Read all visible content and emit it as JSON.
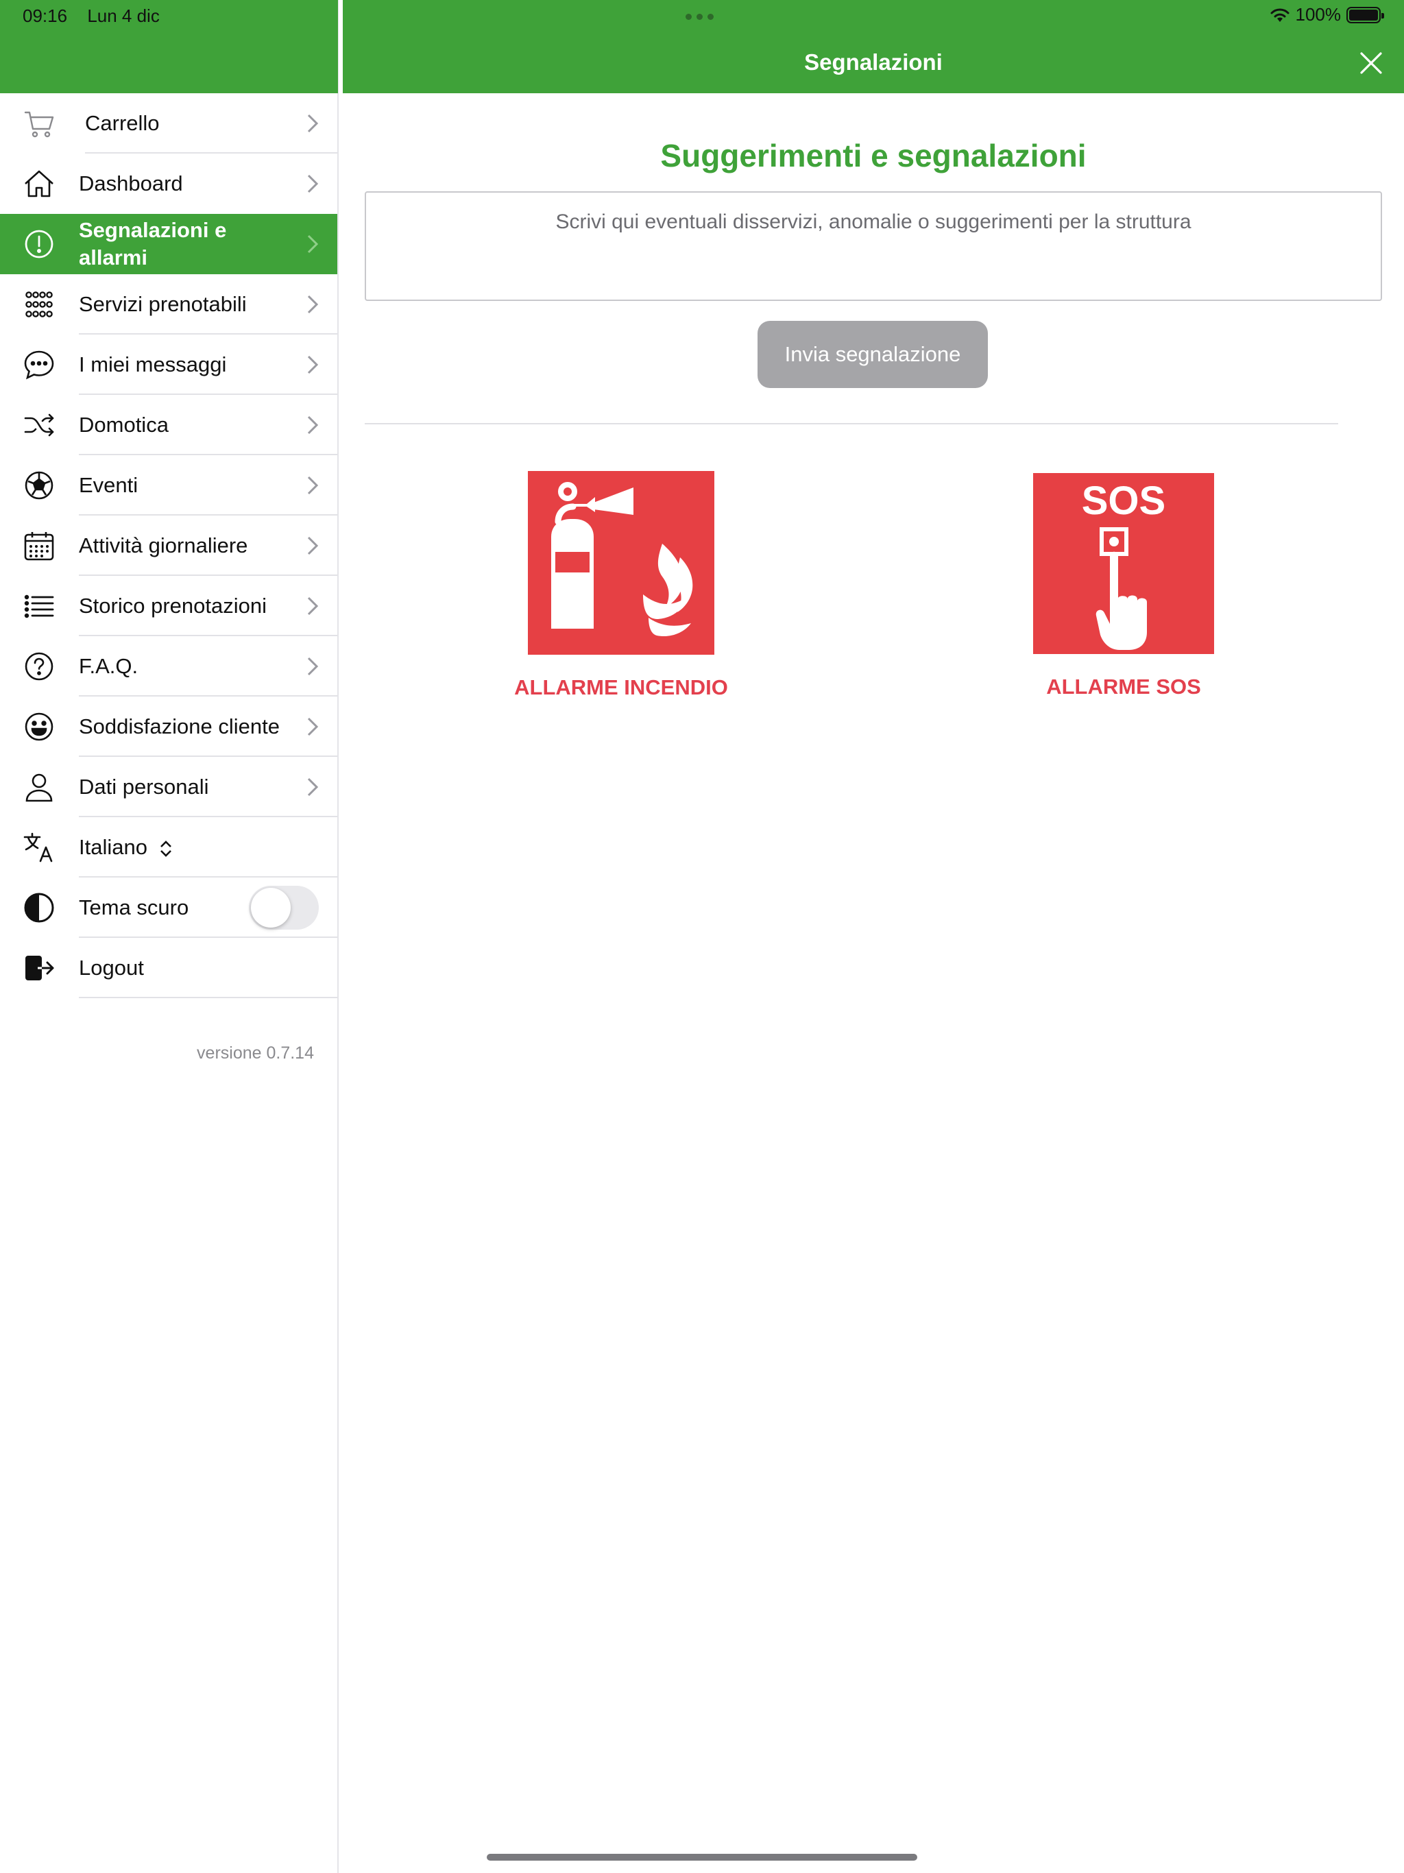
{
  "status_bar": {
    "time": "09:16",
    "date": "Lun 4 dic",
    "battery": "100%"
  },
  "sidebar": {
    "items": [
      {
        "label": "Carrello",
        "icon": "cart-icon"
      },
      {
        "label": "Dashboard",
        "icon": "home-icon"
      },
      {
        "label": "Segnalazioni e allarmi",
        "icon": "alert-circle-icon",
        "active": true
      },
      {
        "label": "Servizi prenotabili",
        "icon": "grid-dots-icon"
      },
      {
        "label": "I miei messaggi",
        "icon": "chat-bubble-icon"
      },
      {
        "label": "Domotica",
        "icon": "shuffle-icon"
      },
      {
        "label": "Eventi",
        "icon": "soccer-ball-icon"
      },
      {
        "label": "Attività giornaliere",
        "icon": "calendar-icon"
      },
      {
        "label": "Storico prenotazioni",
        "icon": "list-icon"
      },
      {
        "label": "F.A.Q.",
        "icon": "question-circle-icon"
      },
      {
        "label": "Soddisfazione cliente",
        "icon": "smiley-icon"
      },
      {
        "label": "Dati personali",
        "icon": "person-icon"
      },
      {
        "label": "Italiano",
        "icon": "translate-icon"
      },
      {
        "label": "Tema scuro",
        "icon": "contrast-icon"
      },
      {
        "label": "Logout",
        "icon": "logout-icon"
      }
    ],
    "dark_theme_enabled": false,
    "version": "versione 0.7.14"
  },
  "main": {
    "header_title": "Segnalazioni",
    "section_title": "Suggerimenti e segnalazioni",
    "textarea_placeholder": "Scrivi qui eventuali disservizi, anomalie o suggerimenti per la struttura",
    "send_label": "Invia segnalazione",
    "fire_alarm_label": "ALLARME INCENDIO",
    "sos_alarm_label": "ALLARME SOS",
    "sos_tile_text": "SOS"
  },
  "colors": {
    "brand_green": "#3fa239",
    "alarm_red": "#e64044",
    "alarm_label_red": "#e3404d",
    "disabled_button": "#a5a5a8"
  }
}
